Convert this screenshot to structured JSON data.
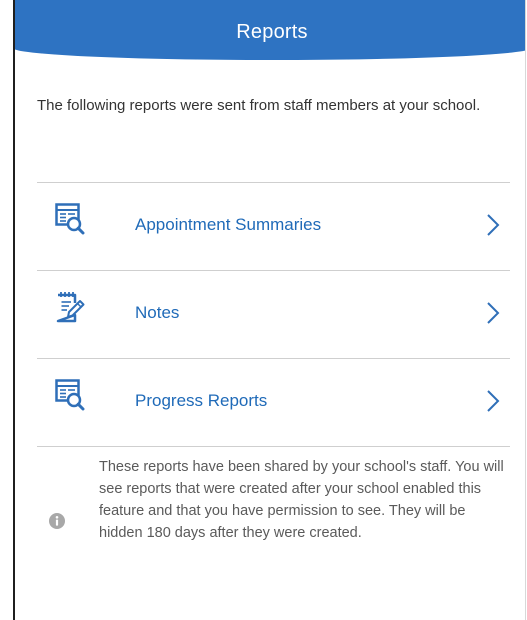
{
  "header": {
    "title": "Reports"
  },
  "intro": {
    "text": "The following reports were sent from staff members at your school."
  },
  "reports": [
    {
      "label": "Appointment Summaries",
      "icon": "report-search-icon"
    },
    {
      "label": "Notes",
      "icon": "notepad-pencil-icon"
    },
    {
      "label": "Progress Reports",
      "icon": "report-search-icon"
    }
  ],
  "info": {
    "icon": "info-icon",
    "text": "These reports have been shared by your school's staff. You will see reports that were created after your school enabled this feature and that you have permission to see. They will be hidden 180 days after they were created."
  },
  "colors": {
    "header_bg": "#2e73c2",
    "link": "#1f6ab8",
    "icon": "#2f6fb8",
    "divider": "#cfcfcf"
  }
}
